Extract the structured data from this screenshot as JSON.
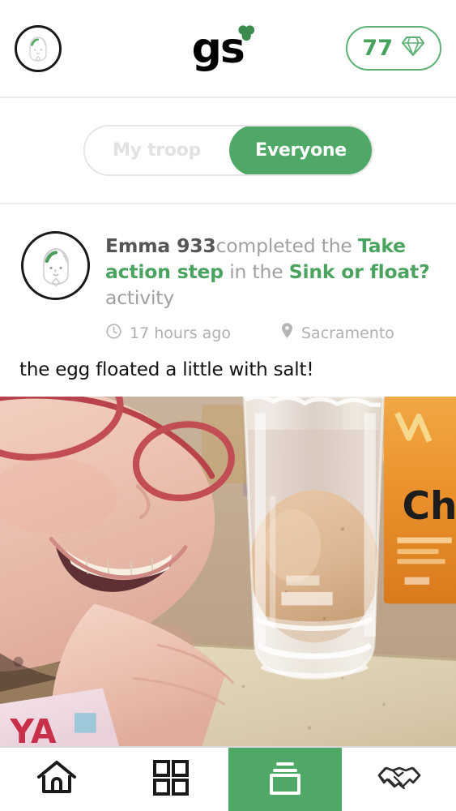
{
  "header": {
    "avatar_alt": "Emma avatar",
    "logo_text": "gs",
    "logo_mark": "trefoil-icon",
    "gem_count": "77",
    "gem_icon": "diamond-icon"
  },
  "feed_filter": {
    "options": [
      {
        "label": "My troop",
        "active": false
      },
      {
        "label": "Everyone",
        "active": true
      }
    ],
    "my_troop_label": "My troop",
    "everyone_label": "Everyone"
  },
  "post": {
    "avatar_alt": "Emma 933 avatar",
    "author": "Emma 933",
    "verb": "completed the ",
    "step_link": "Take action step",
    "connector": " in the ",
    "activity_link": "Sink or float?",
    "suffix": " activity",
    "time": "17 hours ago",
    "time_icon": "clock-icon",
    "location": "Sacramento",
    "location_icon": "location-pin-icon",
    "caption": "the egg floated a little with salt!",
    "photo_alt": "Girl with red glasses smiling beside a glass of water with a floating egg"
  },
  "bottom_nav": {
    "items": [
      {
        "name": "home",
        "icon": "home-icon",
        "active": false
      },
      {
        "name": "browse",
        "icon": "grid-icon",
        "active": false
      },
      {
        "name": "feed",
        "icon": "cards-stack-icon",
        "active": true
      },
      {
        "name": "connect",
        "icon": "handshake-icon",
        "active": false
      }
    ]
  },
  "colors": {
    "brand_green": "#4fa865",
    "link_green": "#4aa35e",
    "badge_green": "#45a15c",
    "muted_gray": "#a0a0a0",
    "author_gray": "#555555",
    "inactive_gray": "#e2e2e2",
    "divider": "#ececec",
    "text_dark": "#121212"
  }
}
